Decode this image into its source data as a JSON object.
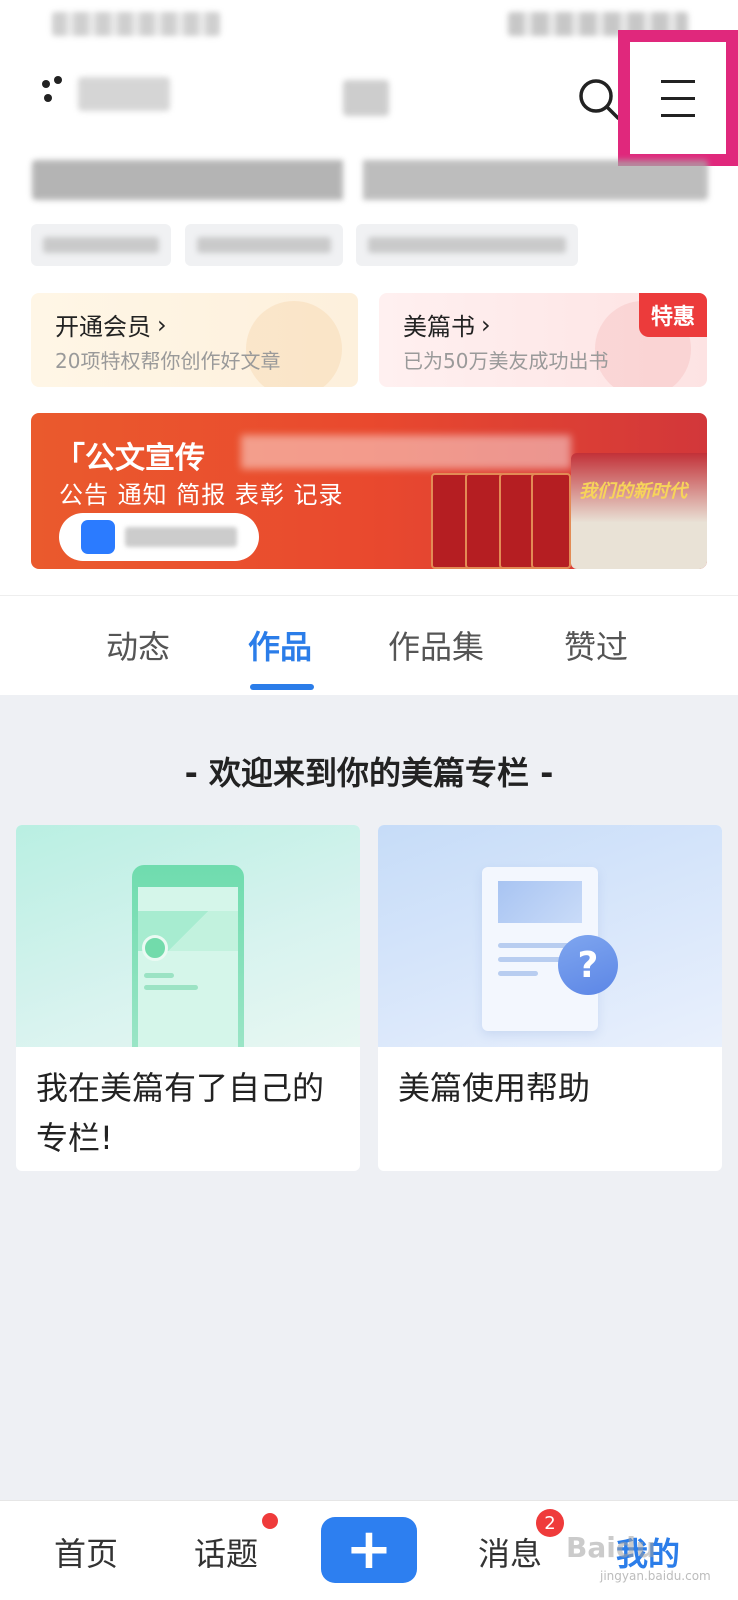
{
  "promo": {
    "vip": {
      "title": "开通会员",
      "arrow": "›",
      "subtitle": "20项特权帮你创作好文章"
    },
    "book": {
      "title": "美篇书",
      "arrow": "›",
      "subtitle": "已为50万美友成功出书",
      "badge": "特惠"
    }
  },
  "banner": {
    "title": "「公文宣传",
    "subtitle": "公告 通知 简报 表彰 记录",
    "hall_label": "我们的新时代"
  },
  "tabs": [
    "动态",
    "作品",
    "作品集",
    "赞过"
  ],
  "active_tab": "作品",
  "column": {
    "heading": "- 欢迎来到你的美篇专栏 -",
    "cards": [
      {
        "label": "我在美篇有了自己的专栏!"
      },
      {
        "label": "美篇使用帮助"
      }
    ],
    "help_symbol": "?"
  },
  "bottom_nav": {
    "items": [
      "首页",
      "话题",
      "消息",
      "我的"
    ],
    "plus": "+",
    "message_count": "2",
    "active": "我的"
  },
  "watermark": {
    "text": "Baidu",
    "sub": "jingyan.baidu.com"
  },
  "colors": {
    "accent": "#2b7de9",
    "highlight_box": "#e0287c",
    "badge": "#ec3b3b"
  },
  "icons": [
    "search-icon",
    "menu-icon",
    "plus-icon",
    "help-icon"
  ]
}
